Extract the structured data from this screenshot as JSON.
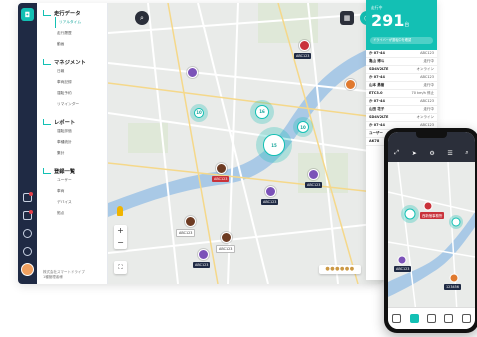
{
  "menu": {
    "sections": [
      {
        "title": "走行データ",
        "items": [
          "リアルタイム",
          "走行履歴",
          "動画"
        ]
      },
      {
        "title": "マネジメント",
        "items": [
          "日報",
          "車両記録",
          "運転予約",
          "リマインダー"
        ]
      },
      {
        "title": "レポート",
        "items": [
          "運転評価",
          "車種統計",
          "集計"
        ]
      },
      {
        "title": "登録一覧",
        "items": [
          "ユーザー",
          "車両",
          "デバイス",
          "拠点"
        ]
      }
    ],
    "footer_line1": "株式会社スマートドライブ",
    "footer_line2": "1種管理者様"
  },
  "map": {
    "vehicle_labels": [
      "ABC123",
      "ABC123",
      "ABC123",
      "ABC123",
      "ABC123",
      "ABC123",
      "ABC123"
    ],
    "clusters": [
      "10",
      "15",
      "16",
      "10"
    ],
    "legend": "●●●●●●"
  },
  "panel": {
    "title": "走行中",
    "count": "291",
    "unit": "台",
    "notice": "ドライバーが運転中を確認",
    "rows": [
      {
        "a": "か 07-44",
        "b": "ABC123"
      },
      {
        "a": "亀山 博斗",
        "b": "走行中"
      },
      {
        "a": "SD4V2LTE",
        "b": "オンライン"
      },
      {
        "a": "か 07-44",
        "b": "ABC123"
      },
      {
        "a": "山本 勇樹",
        "b": "走行中"
      },
      {
        "a": "ETC3.0",
        "b": "70 km/h 停止"
      },
      {
        "a": "か 07-44",
        "b": "ABC123"
      },
      {
        "a": "山田 花子",
        "b": "走行中"
      },
      {
        "a": "SD4V2LTE",
        "b": "オンライン"
      },
      {
        "a": "か 07-44",
        "b": "ABC123"
      },
      {
        "a": "ユーザー",
        "b": ""
      },
      {
        "a": "AK78",
        "b": ""
      }
    ]
  },
  "phone": {
    "labels": [
      "西新宿事務所",
      "ABC123",
      "123456"
    ]
  }
}
